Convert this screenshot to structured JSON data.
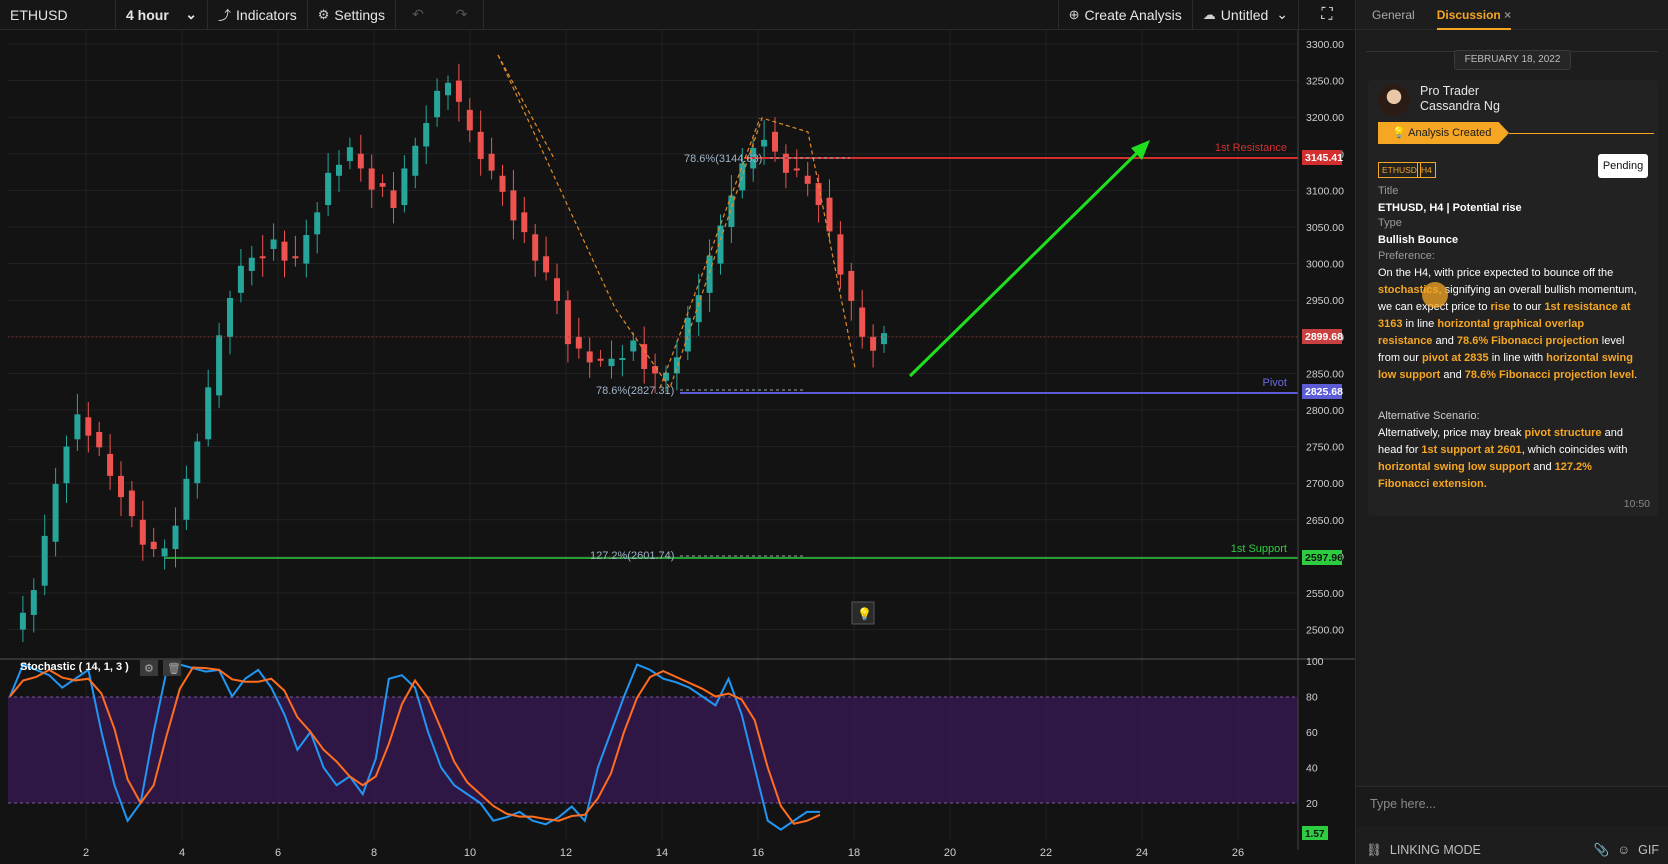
{
  "toolbar": {
    "symbol": "ETHUSD",
    "timeframe": "4 hour",
    "indicators_label": "Indicators",
    "settings_label": "Settings",
    "create_analysis_label": "Create Analysis",
    "untitled_label": "Untitled"
  },
  "chart": {
    "price_axis": [
      "3300.00",
      "3250.00",
      "3200.00",
      "3150.00",
      "3100.00",
      "3050.00",
      "3000.00",
      "2950.00",
      "2900.00",
      "2850.00",
      "2800.00",
      "2750.00",
      "2700.00",
      "2650.00",
      "2600.00",
      "2550.00",
      "2500.00"
    ],
    "date_axis": [
      "2",
      "4",
      "6",
      "8",
      "10",
      "12",
      "14",
      "16",
      "18",
      "20",
      "22",
      "24",
      "26"
    ],
    "resistance_label": "1st Resistance",
    "resistance_value": "3145.41",
    "pivot_label": "Pivot",
    "pivot_value": "2825.68",
    "support_label": "1st Support",
    "support_value": "2597.96",
    "current_price": "2899.68",
    "fib_top": "78.6%(3144.63)",
    "fib_pivot": "78.6%(2827.31)",
    "fib_ext": "127.2%(2601.74)",
    "stoch_title": "Stochastic ( 14, 1, 3 )",
    "stoch_axis": [
      "100",
      "80",
      "60",
      "40",
      "20"
    ],
    "stoch_value": "1.57",
    "colors": {
      "resistance": "#d32f2f",
      "pivot": "#5c5cd6",
      "support": "#2ecc40",
      "bull": "#26a69a",
      "bear": "#ef5350",
      "arrow": "#1ee01e"
    }
  },
  "sidebar": {
    "tab_general": "General",
    "tab_discussion": "Discussion",
    "tab_close": "×",
    "date": "FEBRUARY 18, 2022",
    "author_role": "Pro Trader",
    "author_name": "Cassandra Ng",
    "analysis_badge": "Analysis Created",
    "tag_symbol": "ETHUSD",
    "tag_tf": "H4",
    "status": "Pending",
    "title_label": "Title",
    "title_value": "ETHUSD, H4 | Potential rise",
    "type_label": "Type",
    "type_value": "Bullish Bounce",
    "preference_label": "Preference:",
    "alt_label": "Alternative Scenario:",
    "time": "10:50",
    "input_placeholder": "Type here...",
    "linking_mode": "LINKING MODE",
    "gif_label": "GIF"
  }
}
